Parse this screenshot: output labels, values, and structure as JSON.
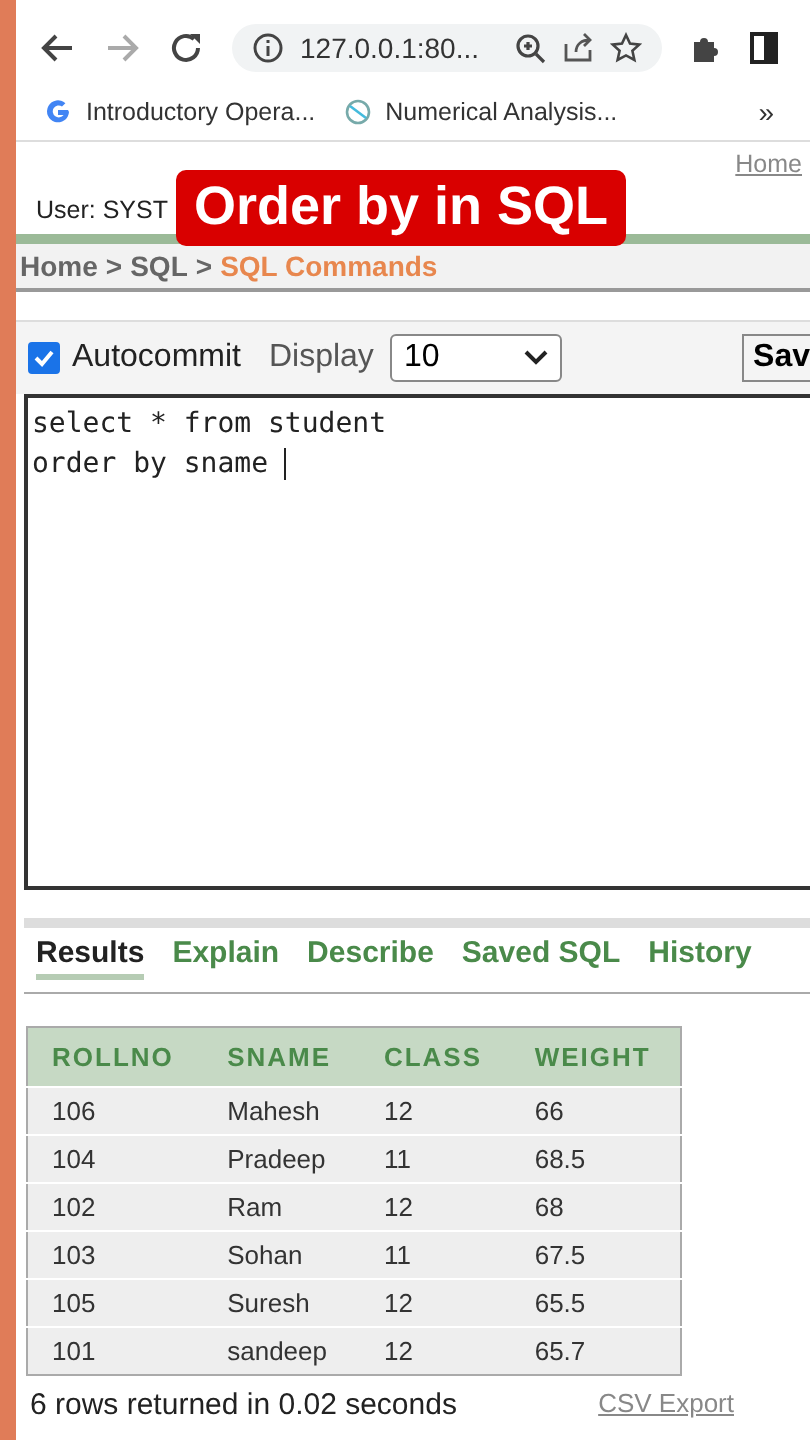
{
  "browser": {
    "address": "127.0.0.1:80...",
    "bookmarks": [
      "Introductory Opera...",
      "Numerical Analysis..."
    ],
    "more": "»"
  },
  "overlay_title": "Order by in SQL",
  "header": {
    "home_link": "Home",
    "user": "User: SYST"
  },
  "breadcrumb": [
    {
      "label": "Home",
      "current": false
    },
    {
      "label": "SQL",
      "current": false
    },
    {
      "label": "SQL Commands",
      "current": true
    }
  ],
  "breadcrumb_separator": ">",
  "toolbar": {
    "autocommit": {
      "label": "Autocommit",
      "checked": true
    },
    "display_label": "Display",
    "display_value": "10",
    "save_button": "Sav"
  },
  "editor": {
    "value": "select * from student\norder by sname "
  },
  "tabs": [
    {
      "label": "Results",
      "selected": true
    },
    {
      "label": "Explain",
      "selected": false
    },
    {
      "label": "Describe",
      "selected": false
    },
    {
      "label": "Saved SQL",
      "selected": false
    },
    {
      "label": "History",
      "selected": false
    }
  ],
  "table": {
    "columns": [
      "ROLLNO",
      "SNAME",
      "CLASS",
      "WEIGHT"
    ],
    "rows": [
      [
        "106",
        "Mahesh",
        "12",
        "66"
      ],
      [
        "104",
        "Pradeep",
        "11",
        "68.5"
      ],
      [
        "102",
        "Ram",
        "12",
        "68"
      ],
      [
        "103",
        "Sohan",
        "11",
        "67.5"
      ],
      [
        "105",
        "Suresh",
        "12",
        "65.5"
      ],
      [
        "101",
        "sandeep",
        "12",
        "65.7"
      ]
    ]
  },
  "status": "6 rows returned in 0.02 seconds",
  "csv_link": "CSV Export"
}
